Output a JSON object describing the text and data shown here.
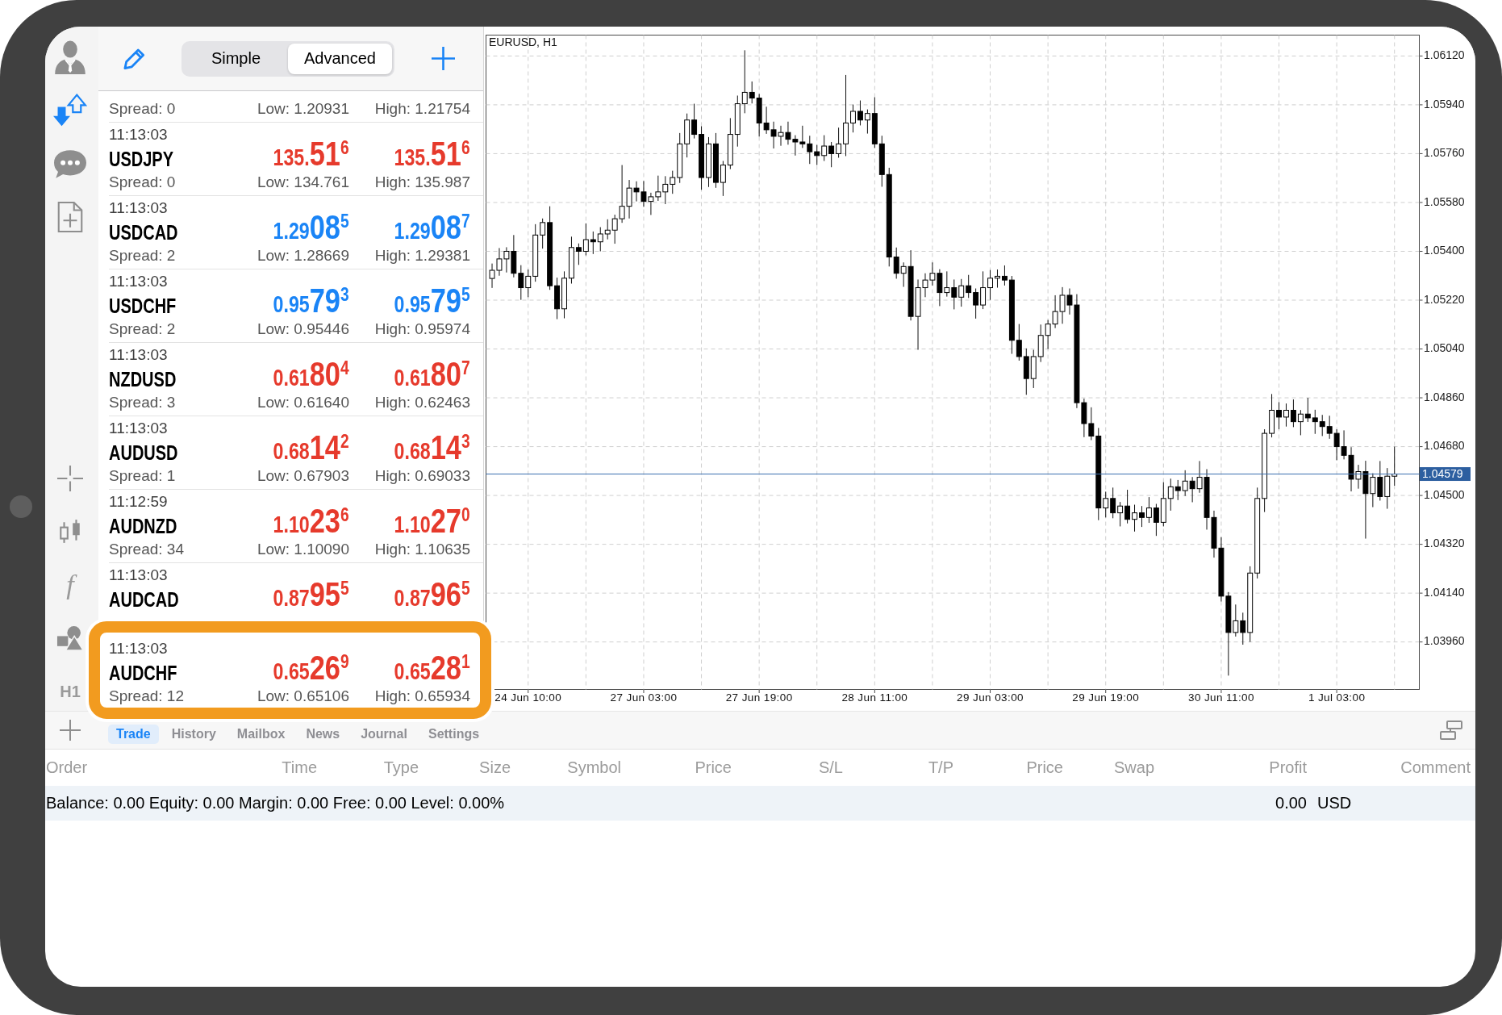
{
  "toolbar": {
    "modes": [
      {
        "label": "Simple",
        "selected": false
      },
      {
        "label": "Advanced",
        "selected": true
      }
    ]
  },
  "tool_column": {
    "indicator_label": "f",
    "timeframe": "H1"
  },
  "cut_off_row": {
    "spread": "Spread: 0",
    "low": "Low: 1.20931",
    "high": "High: 1.21754"
  },
  "quotes": [
    {
      "time": "11:13:03",
      "symbol": "USDJPY",
      "color": "#e63a2c",
      "bid": {
        "prefix": "135.",
        "pips": "51",
        "point": "6"
      },
      "ask": {
        "prefix": "135.",
        "pips": "51",
        "point": "6"
      },
      "spread": "Spread: 0",
      "low": "Low: 134.761",
      "high": "High: 135.987",
      "highlighted": false
    },
    {
      "time": "11:13:03",
      "symbol": "USDCAD",
      "color": "#1a84f6",
      "bid": {
        "prefix": "1.29",
        "pips": "08",
        "point": "5"
      },
      "ask": {
        "prefix": "1.29",
        "pips": "08",
        "point": "7"
      },
      "spread": "Spread: 2",
      "low": "Low: 1.28669",
      "high": "High: 1.29381",
      "highlighted": false
    },
    {
      "time": "11:13:03",
      "symbol": "USDCHF",
      "color": "#1a84f6",
      "bid": {
        "prefix": "0.95",
        "pips": "79",
        "point": "3"
      },
      "ask": {
        "prefix": "0.95",
        "pips": "79",
        "point": "5"
      },
      "spread": "Spread: 2",
      "low": "Low: 0.95446",
      "high": "High: 0.95974",
      "highlighted": false
    },
    {
      "time": "11:13:03",
      "symbol": "NZDUSD",
      "color": "#e63a2c",
      "bid": {
        "prefix": "0.61",
        "pips": "80",
        "point": "4"
      },
      "ask": {
        "prefix": "0.61",
        "pips": "80",
        "point": "7"
      },
      "spread": "Spread: 3",
      "low": "Low: 0.61640",
      "high": "High: 0.62463",
      "highlighted": false
    },
    {
      "time": "11:13:03",
      "symbol": "AUDUSD",
      "color": "#e63a2c",
      "bid": {
        "prefix": "0.68",
        "pips": "14",
        "point": "2"
      },
      "ask": {
        "prefix": "0.68",
        "pips": "14",
        "point": "3"
      },
      "spread": "Spread: 1",
      "low": "Low: 0.67903",
      "high": "High: 0.69033",
      "highlighted": false
    },
    {
      "time": "11:12:59",
      "symbol": "AUDNZD",
      "color": "#e63a2c",
      "bid": {
        "prefix": "1.10",
        "pips": "23",
        "point": "6"
      },
      "ask": {
        "prefix": "1.10",
        "pips": "27",
        "point": "0"
      },
      "spread": "Spread: 34",
      "low": "Low: 1.10090",
      "high": "High: 1.10635",
      "highlighted": false
    },
    {
      "time": "11:13:03",
      "symbol": "AUDCAD",
      "color": "#e63a2c",
      "bid": {
        "prefix": "0.87",
        "pips": "95",
        "point": "5"
      },
      "ask": {
        "prefix": "0.87",
        "pips": "96",
        "point": "5"
      },
      "highlighted": false
    },
    {
      "time": "11:13:03",
      "symbol": "AUDCHF",
      "color": "#e63a2c",
      "bid": {
        "prefix": "0.65",
        "pips": "26",
        "point": "9"
      },
      "ask": {
        "prefix": "0.65",
        "pips": "28",
        "point": "1"
      },
      "spread": "Spread: 12",
      "low": "Low: 0.65106",
      "high": "High: 0.65934",
      "highlighted": true
    }
  ],
  "chart": {
    "chart_data": {
      "type": "candlestick",
      "title": "EURUSD, H1",
      "grid": true,
      "categories": [
        null,
        null,
        null,
        null,
        null,
        "24 Jun 10:00",
        null,
        null,
        null,
        null,
        null,
        null,
        null,
        null,
        null,
        null,
        null,
        null,
        null,
        null,
        null,
        "27 Jun 03:00",
        null,
        null,
        null,
        null,
        null,
        null,
        null,
        null,
        null,
        null,
        null,
        null,
        null,
        null,
        null,
        "27 Jun 19:00",
        null,
        null,
        null,
        null,
        null,
        null,
        null,
        null,
        null,
        null,
        null,
        null,
        null,
        null,
        null,
        "28 Jun 11:00",
        null,
        null,
        null,
        null,
        null,
        null,
        null,
        null,
        null,
        null,
        null,
        null,
        null,
        null,
        null,
        "29 Jun 03:00",
        null,
        null,
        null,
        null,
        null,
        null,
        null,
        null,
        null,
        null,
        null,
        null,
        null,
        null,
        null,
        "29 Jun 19:00",
        null,
        null,
        null,
        null,
        null,
        null,
        null,
        null,
        null,
        null,
        null,
        null,
        null,
        null,
        null,
        "30 Jun 11:00",
        null,
        null,
        null,
        null,
        null,
        null,
        null,
        null,
        null,
        null,
        null,
        null,
        null,
        null,
        null,
        "1 Jul 03:00",
        null,
        null,
        null,
        null,
        null,
        null,
        null,
        null
      ],
      "ohlc": [
        [
          1.053,
          1.05355,
          1.05265,
          1.0533
        ],
        [
          1.0533,
          1.05412,
          1.0531,
          1.05372
        ],
        [
          1.05372,
          1.05415,
          1.05322,
          1.054
        ],
        [
          1.054,
          1.0546,
          1.05304,
          1.05319
        ],
        [
          1.05319,
          1.05349,
          1.05221,
          1.05266
        ],
        [
          1.05266,
          1.05333,
          1.05231,
          1.05308
        ],
        [
          1.05308,
          1.055,
          1.05288,
          1.0546
        ],
        [
          1.0546,
          1.05521,
          1.0541,
          1.05506
        ],
        [
          1.05506,
          1.05566,
          1.05258,
          1.05273
        ],
        [
          1.05273,
          1.05303,
          1.0515,
          1.05188
        ],
        [
          1.05188,
          1.05326,
          1.05153,
          1.05301
        ],
        [
          1.05301,
          1.05454,
          1.05281,
          1.05414
        ],
        [
          1.05414,
          1.05429,
          1.0535,
          1.054
        ],
        [
          1.054,
          1.05503,
          1.05385,
          1.05443
        ],
        [
          1.05443,
          1.05473,
          1.0539,
          1.05435
        ],
        [
          1.05435,
          1.05489,
          1.054,
          1.05464
        ],
        [
          1.05464,
          1.05518,
          1.05444,
          1.05478
        ],
        [
          1.05478,
          1.05535,
          1.05428,
          1.0552
        ],
        [
          1.0552,
          1.05718,
          1.05505,
          1.05566
        ],
        [
          1.05566,
          1.05663,
          1.05521,
          1.05633
        ],
        [
          1.05633,
          1.05658,
          1.05584,
          1.05619
        ],
        [
          1.05619,
          1.05659,
          1.05564,
          1.05584
        ],
        [
          1.05584,
          1.05616,
          1.05534,
          1.05601
        ],
        [
          1.05601,
          1.05679,
          1.05586,
          1.05619
        ],
        [
          1.05619,
          1.05677,
          1.05574,
          1.05647
        ],
        [
          1.05647,
          1.05697,
          1.05612,
          1.05672
        ],
        [
          1.05672,
          1.05836,
          1.05652,
          1.05796
        ],
        [
          1.05796,
          1.05908,
          1.05746,
          1.05884
        ],
        [
          1.05884,
          1.05944,
          1.05816,
          1.05831
        ],
        [
          1.05831,
          1.05861,
          1.05627,
          1.05672
        ],
        [
          1.05672,
          1.05821,
          1.05637,
          1.05796
        ],
        [
          1.05796,
          1.05836,
          1.05634,
          1.05654
        ],
        [
          1.05654,
          1.05733,
          1.05604,
          1.05718
        ],
        [
          1.05718,
          1.05891,
          1.05703,
          1.05831
        ],
        [
          1.05831,
          1.05974,
          1.05786,
          1.05944
        ],
        [
          1.05944,
          1.06141,
          1.05909,
          1.05986
        ],
        [
          1.05986,
          1.06026,
          1.05945,
          1.05965
        ],
        [
          1.05965,
          1.0598,
          1.05823,
          1.05873
        ],
        [
          1.05873,
          1.05933,
          1.05833,
          1.05848
        ],
        [
          1.05848,
          1.05878,
          1.05779,
          1.05824
        ],
        [
          1.05824,
          1.05863,
          1.05789,
          1.05838
        ],
        [
          1.05838,
          1.05878,
          1.05793,
          1.05813
        ],
        [
          1.05813,
          1.05828,
          1.05753,
          1.05803
        ],
        [
          1.05803,
          1.05863,
          1.05781,
          1.05796
        ],
        [
          1.05796,
          1.05826,
          1.05722,
          1.05767
        ],
        [
          1.05767,
          1.05792,
          1.05718,
          1.05753
        ],
        [
          1.05753,
          1.05828,
          1.05733,
          1.05788
        ],
        [
          1.05788,
          1.05803,
          1.0571,
          1.0576
        ],
        [
          1.0576,
          1.05856,
          1.05745,
          1.05796
        ],
        [
          1.05796,
          1.0605,
          1.05751,
          1.05873
        ],
        [
          1.05873,
          1.05941,
          1.05838,
          1.05916
        ],
        [
          1.05916,
          1.05956,
          1.05864,
          1.05884
        ],
        [
          1.05884,
          1.05923,
          1.05834,
          1.05908
        ],
        [
          1.05908,
          1.05968,
          1.05781,
          1.05796
        ],
        [
          1.05796,
          1.05826,
          1.05638,
          1.05683
        ],
        [
          1.05683,
          1.05708,
          1.05344,
          1.05379
        ],
        [
          1.05379,
          1.05414,
          1.05299,
          1.05319
        ],
        [
          1.05319,
          1.05359,
          1.05269,
          1.05344
        ],
        [
          1.05344,
          1.05404,
          1.05145,
          1.0516
        ],
        [
          1.0516,
          1.05296,
          1.05037,
          1.05266
        ],
        [
          1.05266,
          1.05319,
          1.05231,
          1.05294
        ],
        [
          1.05294,
          1.05359,
          1.05274,
          1.05319
        ],
        [
          1.05319,
          1.05334,
          1.05198,
          1.05248
        ],
        [
          1.05248,
          1.05326,
          1.05233,
          1.05266
        ],
        [
          1.05266,
          1.05296,
          1.05186,
          1.05231
        ],
        [
          1.05231,
          1.05298,
          1.05196,
          1.05273
        ],
        [
          1.05273,
          1.05313,
          1.05228,
          1.05248
        ],
        [
          1.05248,
          1.05263,
          1.05152,
          1.05202
        ],
        [
          1.05202,
          1.05326,
          1.05187,
          1.05266
        ],
        [
          1.05266,
          1.05331,
          1.05221,
          1.05301
        ],
        [
          1.05301,
          1.05333,
          1.05266,
          1.05308
        ],
        [
          1.05308,
          1.05348,
          1.05274,
          1.05294
        ],
        [
          1.05294,
          1.05309,
          1.05022,
          1.05072
        ],
        [
          1.05072,
          1.05132,
          1.04997,
          1.05012
        ],
        [
          1.05012,
          1.05042,
          1.04871,
          1.04931
        ],
        [
          1.04931,
          1.05037,
          1.04896,
          1.05012
        ],
        [
          1.05012,
          1.0513,
          1.04992,
          1.0509
        ],
        [
          1.0509,
          1.05147,
          1.0504,
          1.05132
        ],
        [
          1.05132,
          1.05238,
          1.05117,
          1.05178
        ],
        [
          1.05178,
          1.05268,
          1.05133,
          1.05238
        ],
        [
          1.05238,
          1.05263,
          1.05167,
          1.05202
        ],
        [
          1.05202,
          1.05242,
          1.04822,
          1.04842
        ],
        [
          1.04842,
          1.04857,
          1.04715,
          1.04765
        ],
        [
          1.04765,
          1.04825,
          1.04704,
          1.04719
        ],
        [
          1.04719,
          1.04749,
          1.04409,
          1.04454
        ],
        [
          1.04454,
          1.04514,
          1.04419,
          1.04489
        ],
        [
          1.04489,
          1.04529,
          1.04416,
          1.04436
        ],
        [
          1.04436,
          1.04476,
          1.04386,
          1.04461
        ],
        [
          1.04461,
          1.04521,
          1.04397,
          1.04412
        ],
        [
          1.04412,
          1.04466,
          1.04367,
          1.04436
        ],
        [
          1.04436,
          1.04461,
          1.04384,
          1.04419
        ],
        [
          1.04419,
          1.04494,
          1.04399,
          1.04454
        ],
        [
          1.04454,
          1.04469,
          1.04351,
          1.04401
        ],
        [
          1.04401,
          1.04549,
          1.04386,
          1.04489
        ],
        [
          1.04489,
          1.04562,
          1.04444,
          1.04532
        ],
        [
          1.04532,
          1.04557,
          1.04483,
          1.04518
        ],
        [
          1.04518,
          1.04593,
          1.04498,
          1.04553
        ],
        [
          1.04553,
          1.04568,
          1.04475,
          1.04525
        ],
        [
          1.04525,
          1.04627,
          1.0451,
          1.04567
        ],
        [
          1.04567,
          1.04597,
          1.04374,
          1.04419
        ],
        [
          1.04419,
          1.04444,
          1.04271,
          1.04306
        ],
        [
          1.04306,
          1.04346,
          1.04109,
          1.04129
        ],
        [
          1.04129,
          1.04144,
          1.03836,
          1.03995
        ],
        [
          1.03995,
          1.04098,
          1.0398,
          1.04038
        ],
        [
          1.04038,
          1.04068,
          1.0395,
          1.03995
        ],
        [
          1.03995,
          1.04239,
          1.0396,
          1.04214
        ],
        [
          1.04214,
          1.04529,
          1.04194,
          1.04489
        ],
        [
          1.04489,
          1.04744,
          1.04439,
          1.04729
        ],
        [
          1.04729,
          1.04874,
          1.04714,
          1.04814
        ],
        [
          1.04814,
          1.04844,
          1.04744,
          1.04789
        ],
        [
          1.04789,
          1.04839,
          1.04754,
          1.04814
        ],
        [
          1.04814,
          1.04854,
          1.04752,
          1.04772
        ],
        [
          1.04772,
          1.04815,
          1.04722,
          1.048
        ],
        [
          1.048,
          1.0486,
          1.04771,
          1.04786
        ],
        [
          1.04786,
          1.04816,
          1.04727,
          1.04772
        ],
        [
          1.04772,
          1.04797,
          1.04719,
          1.04754
        ],
        [
          1.04754,
          1.04794,
          1.04709,
          1.04729
        ],
        [
          1.04729,
          1.04744,
          1.0463,
          1.0468
        ],
        [
          1.0468,
          1.0474,
          1.04633,
          1.04648
        ],
        [
          1.04648,
          1.04678,
          1.04515,
          1.0456
        ],
        [
          1.0456,
          1.04613,
          1.04525,
          1.04588
        ],
        [
          1.04588,
          1.04628,
          1.04341,
          1.04507
        ],
        [
          1.04507,
          1.04582,
          1.04457,
          1.04567
        ],
        [
          1.04567,
          1.04627,
          1.04481,
          1.04496
        ],
        [
          1.04496,
          1.04601,
          1.04451,
          1.04571
        ],
        [
          1.04571,
          1.0468,
          1.04536,
          1.04579
        ]
      ],
      "ylim": [
        1.03785,
        1.06197
      ],
      "yticks": [
        {
          "value": 1.0612,
          "label": "1.06120"
        },
        {
          "value": 1.0594,
          "label": "1.05940"
        },
        {
          "value": 1.0576,
          "label": "1.05760"
        },
        {
          "value": 1.0558,
          "label": "1.05580"
        },
        {
          "value": 1.054,
          "label": "1.05400"
        },
        {
          "value": 1.0522,
          "label": "1.05220"
        },
        {
          "value": 1.0504,
          "label": "1.05040"
        },
        {
          "value": 1.0486,
          "label": "1.04860"
        },
        {
          "value": 1.0468,
          "label": "1.04680"
        },
        {
          "value": 1.045,
          "label": "1.04500"
        },
        {
          "value": 1.0432,
          "label": "1.04320"
        },
        {
          "value": 1.0414,
          "label": "1.04140"
        },
        {
          "value": 1.0396,
          "label": "1.03960"
        }
      ],
      "ref_lines": [
        {
          "axis": "y",
          "value": 1.04579,
          "label": "1.04579"
        }
      ]
    }
  },
  "bottom_tabs": [
    {
      "label": "Trade",
      "selected": true
    },
    {
      "label": "History",
      "selected": false
    },
    {
      "label": "Mailbox",
      "selected": false
    },
    {
      "label": "News",
      "selected": false
    },
    {
      "label": "Journal",
      "selected": false
    },
    {
      "label": "Settings",
      "selected": false
    }
  ],
  "table": {
    "columns": [
      "Order",
      "Time",
      "Type",
      "Size",
      "Symbol",
      "Price",
      "S/L",
      "T/P",
      "Price",
      "Swap",
      "Profit",
      "Comment"
    ]
  },
  "account_summary": {
    "text": "Balance: 0.00 Equity: 0.00 Margin: 0.00 Free: 0.00 Level: 0.00%",
    "profit": "0.00",
    "currency": "USD"
  }
}
